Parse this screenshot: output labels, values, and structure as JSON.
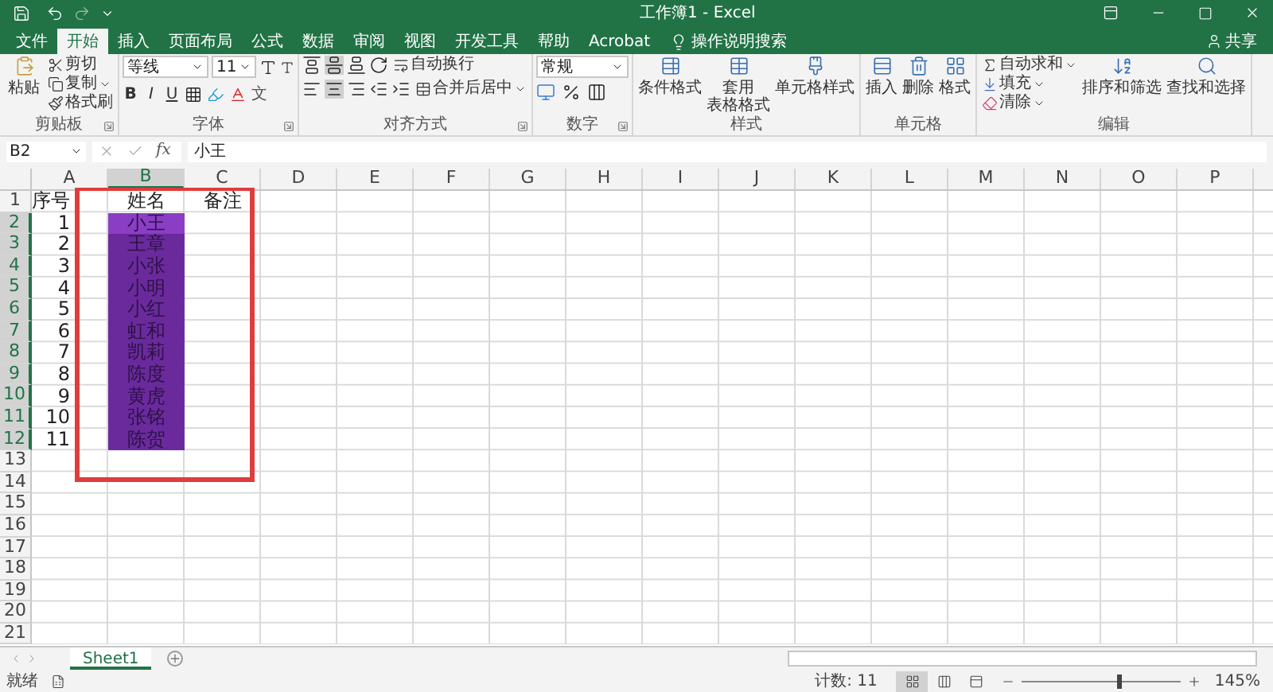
{
  "title_bar": {
    "title": "工作簿1 - Excel"
  },
  "menu_tabs": [
    {
      "label": "文件",
      "selected": false
    },
    {
      "label": "开始",
      "selected": true
    },
    {
      "label": "插入",
      "selected": false
    },
    {
      "label": "页面布局",
      "selected": false
    },
    {
      "label": "公式",
      "selected": false
    },
    {
      "label": "数据",
      "selected": false
    },
    {
      "label": "审阅",
      "selected": false
    },
    {
      "label": "视图",
      "selected": false
    },
    {
      "label": "开发工具",
      "selected": false
    },
    {
      "label": "帮助",
      "selected": false
    },
    {
      "label": "Acrobat",
      "selected": false
    }
  ],
  "tell_me": "操作说明搜索",
  "share": "共享",
  "ribbon": {
    "groups": [
      {
        "kind": "clipboard",
        "label": "剪贴板",
        "paste": "粘贴",
        "items": [
          "剪切",
          "复制",
          "格式刷"
        ]
      },
      {
        "kind": "font",
        "label": "字体",
        "font": "等线",
        "size": "11",
        "styles": [
          "B",
          "I",
          "U"
        ],
        "phonetic": "文"
      },
      {
        "kind": "alignment",
        "label": "对齐方式",
        "wrap": "自动换行",
        "merge": "合并后居中"
      },
      {
        "kind": "number",
        "label": "数字",
        "format": "常规"
      },
      {
        "kind": "styles",
        "label": "样式",
        "items": [
          [
            "条件格式"
          ],
          [
            "套用",
            "表格格式"
          ],
          [
            "单元格样式"
          ]
        ]
      },
      {
        "kind": "cells",
        "label": "单元格",
        "items": [
          "插入",
          "删除",
          "格式"
        ]
      },
      {
        "kind": "editing",
        "label": "编辑",
        "small": [
          "自动求和",
          "填充",
          "清除"
        ],
        "large": [
          "排序和筛选",
          "查找和选择"
        ]
      }
    ]
  },
  "formula_bar": {
    "name_box": "B2",
    "function_label": "fx",
    "value": "小王"
  },
  "columns": [
    {
      "label": "A",
      "selected": false
    },
    {
      "label": "B",
      "selected": true
    },
    {
      "label": "C",
      "selected": false
    },
    {
      "label": "D",
      "selected": false
    },
    {
      "label": "E",
      "selected": false
    },
    {
      "label": "F",
      "selected": false
    },
    {
      "label": "G",
      "selected": false
    },
    {
      "label": "H",
      "selected": false
    },
    {
      "label": "I",
      "selected": false
    },
    {
      "label": "J",
      "selected": false
    },
    {
      "label": "K",
      "selected": false
    },
    {
      "label": "L",
      "selected": false
    },
    {
      "label": "M",
      "selected": false
    },
    {
      "label": "N",
      "selected": false
    },
    {
      "label": "O",
      "selected": false
    },
    {
      "label": "P",
      "selected": false
    }
  ],
  "rows": [
    {
      "header": "1",
      "selected": false,
      "a": "序号",
      "b": "姓名",
      "c": "备注",
      "b_selected": false,
      "active": false
    },
    {
      "header": "2",
      "selected": true,
      "a": "1",
      "b": "小王",
      "b_selected": true,
      "active": true
    },
    {
      "header": "3",
      "selected": true,
      "a": "2",
      "b": "王章",
      "b_selected": true,
      "active": false
    },
    {
      "header": "4",
      "selected": true,
      "a": "3",
      "b": "小张",
      "b_selected": true,
      "active": false
    },
    {
      "header": "5",
      "selected": true,
      "a": "4",
      "b": "小明",
      "b_selected": true,
      "active": false
    },
    {
      "header": "6",
      "selected": true,
      "a": "5",
      "b": "小红",
      "b_selected": true,
      "active": false
    },
    {
      "header": "7",
      "selected": true,
      "a": "6",
      "b": "虹和",
      "b_selected": true,
      "active": false
    },
    {
      "header": "8",
      "selected": true,
      "a": "7",
      "b": "凯莉",
      "b_selected": true,
      "active": false
    },
    {
      "header": "9",
      "selected": true,
      "a": "8",
      "b": "陈度",
      "b_selected": true,
      "active": false
    },
    {
      "header": "10",
      "selected": true,
      "a": "9",
      "b": "黄虎",
      "b_selected": true,
      "active": false
    },
    {
      "header": "11",
      "selected": true,
      "a": "10",
      "b": "张铭",
      "b_selected": true,
      "active": false
    },
    {
      "header": "12",
      "selected": true,
      "a": "11",
      "b": "陈贺",
      "b_selected": true,
      "active": false
    },
    {
      "header": "13",
      "selected": false
    },
    {
      "header": "14",
      "selected": false
    },
    {
      "header": "15",
      "selected": false
    },
    {
      "header": "16",
      "selected": false
    },
    {
      "header": "17",
      "selected": false
    },
    {
      "header": "18",
      "selected": false
    },
    {
      "header": "19",
      "selected": false
    },
    {
      "header": "20",
      "selected": false
    },
    {
      "header": "21",
      "selected": false
    }
  ],
  "sheet_tabs": [
    {
      "label": "Sheet1",
      "selected": true
    }
  ],
  "status_bar": {
    "status": "就绪",
    "count": "计数: 11",
    "zoom": "145%",
    "zoom_slider": {
      "level": 0.6
    },
    "views": [
      {
        "selected": true
      },
      {
        "selected": false
      },
      {
        "selected": false
      }
    ]
  }
}
